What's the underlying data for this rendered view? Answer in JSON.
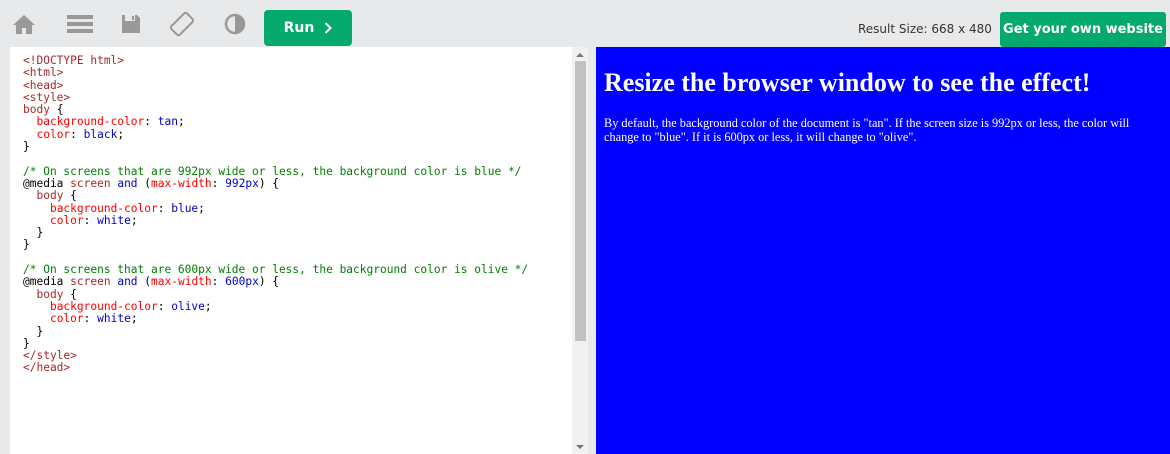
{
  "toolbar": {
    "icons": [
      "home-icon",
      "menu-icon",
      "save-icon",
      "rotate-icon",
      "theme-icon"
    ],
    "run_label": "Run",
    "result_size": "Result Size: 668 x 480",
    "get_website_label": "Get your own website",
    "accent_color": "#04aa6d"
  },
  "editor": {
    "lines": [
      [
        {
          "c": "tag",
          "t": "<!DOCTYPE html>"
        }
      ],
      [
        {
          "c": "tag",
          "t": "<html>"
        }
      ],
      [
        {
          "c": "tag",
          "t": "<head>"
        }
      ],
      [
        {
          "c": "tag",
          "t": "<style>"
        }
      ],
      [
        {
          "c": "sel",
          "t": "body"
        },
        {
          "c": "",
          "t": " {"
        }
      ],
      [
        {
          "c": "",
          "t": "  "
        },
        {
          "c": "prop",
          "t": "background-color"
        },
        {
          "c": "",
          "t": ": "
        },
        {
          "c": "val",
          "t": "tan"
        },
        {
          "c": "",
          "t": ";"
        }
      ],
      [
        {
          "c": "",
          "t": "  "
        },
        {
          "c": "prop",
          "t": "color"
        },
        {
          "c": "",
          "t": ": "
        },
        {
          "c": "val",
          "t": "black"
        },
        {
          "c": "",
          "t": ";"
        }
      ],
      [
        {
          "c": "",
          "t": "}"
        }
      ],
      [
        {
          "c": "",
          "t": ""
        }
      ],
      [
        {
          "c": "com",
          "t": "/* On screens that are 992px wide or less, the background color is blue */"
        }
      ],
      [
        {
          "c": "",
          "t": "@media "
        },
        {
          "c": "kw",
          "t": "screen"
        },
        {
          "c": "",
          "t": " "
        },
        {
          "c": "val",
          "t": "and"
        },
        {
          "c": "",
          "t": " ("
        },
        {
          "c": "prop",
          "t": "max-width"
        },
        {
          "c": "",
          "t": ": "
        },
        {
          "c": "val",
          "t": "992px"
        },
        {
          "c": "",
          "t": ") {"
        }
      ],
      [
        {
          "c": "",
          "t": "  "
        },
        {
          "c": "sel",
          "t": "body"
        },
        {
          "c": "",
          "t": " {"
        }
      ],
      [
        {
          "c": "",
          "t": "    "
        },
        {
          "c": "prop",
          "t": "background-color"
        },
        {
          "c": "",
          "t": ": "
        },
        {
          "c": "val",
          "t": "blue"
        },
        {
          "c": "",
          "t": ";"
        }
      ],
      [
        {
          "c": "",
          "t": "    "
        },
        {
          "c": "prop",
          "t": "color"
        },
        {
          "c": "",
          "t": ": "
        },
        {
          "c": "val",
          "t": "white"
        },
        {
          "c": "",
          "t": ";"
        }
      ],
      [
        {
          "c": "",
          "t": "  }"
        }
      ],
      [
        {
          "c": "",
          "t": "}"
        }
      ],
      [
        {
          "c": "",
          "t": ""
        }
      ],
      [
        {
          "c": "com",
          "t": "/* On screens that are 600px wide or less, the background color is olive */"
        }
      ],
      [
        {
          "c": "",
          "t": "@media "
        },
        {
          "c": "kw",
          "t": "screen"
        },
        {
          "c": "",
          "t": " "
        },
        {
          "c": "val",
          "t": "and"
        },
        {
          "c": "",
          "t": " ("
        },
        {
          "c": "prop",
          "t": "max-width"
        },
        {
          "c": "",
          "t": ": "
        },
        {
          "c": "val",
          "t": "600px"
        },
        {
          "c": "",
          "t": ") {"
        }
      ],
      [
        {
          "c": "",
          "t": "  "
        },
        {
          "c": "sel",
          "t": "body"
        },
        {
          "c": "",
          "t": " {"
        }
      ],
      [
        {
          "c": "",
          "t": "    "
        },
        {
          "c": "prop",
          "t": "background-color"
        },
        {
          "c": "",
          "t": ": "
        },
        {
          "c": "val",
          "t": "olive"
        },
        {
          "c": "",
          "t": ";"
        }
      ],
      [
        {
          "c": "",
          "t": "    "
        },
        {
          "c": "prop",
          "t": "color"
        },
        {
          "c": "",
          "t": ": "
        },
        {
          "c": "val",
          "t": "white"
        },
        {
          "c": "",
          "t": ";"
        }
      ],
      [
        {
          "c": "",
          "t": "  }"
        }
      ],
      [
        {
          "c": "",
          "t": "}"
        }
      ],
      [
        {
          "c": "tag",
          "t": "</style>"
        }
      ],
      [
        {
          "c": "tag",
          "t": "</head>"
        }
      ]
    ]
  },
  "result": {
    "background": "#0000ff",
    "heading": "Resize the browser window to see the effect!",
    "paragraph": "By default, the background color of the document is \"tan\". If the screen size is 992px or less, the color will change to \"blue\". If it is 600px or less, it will change to \"olive\"."
  }
}
